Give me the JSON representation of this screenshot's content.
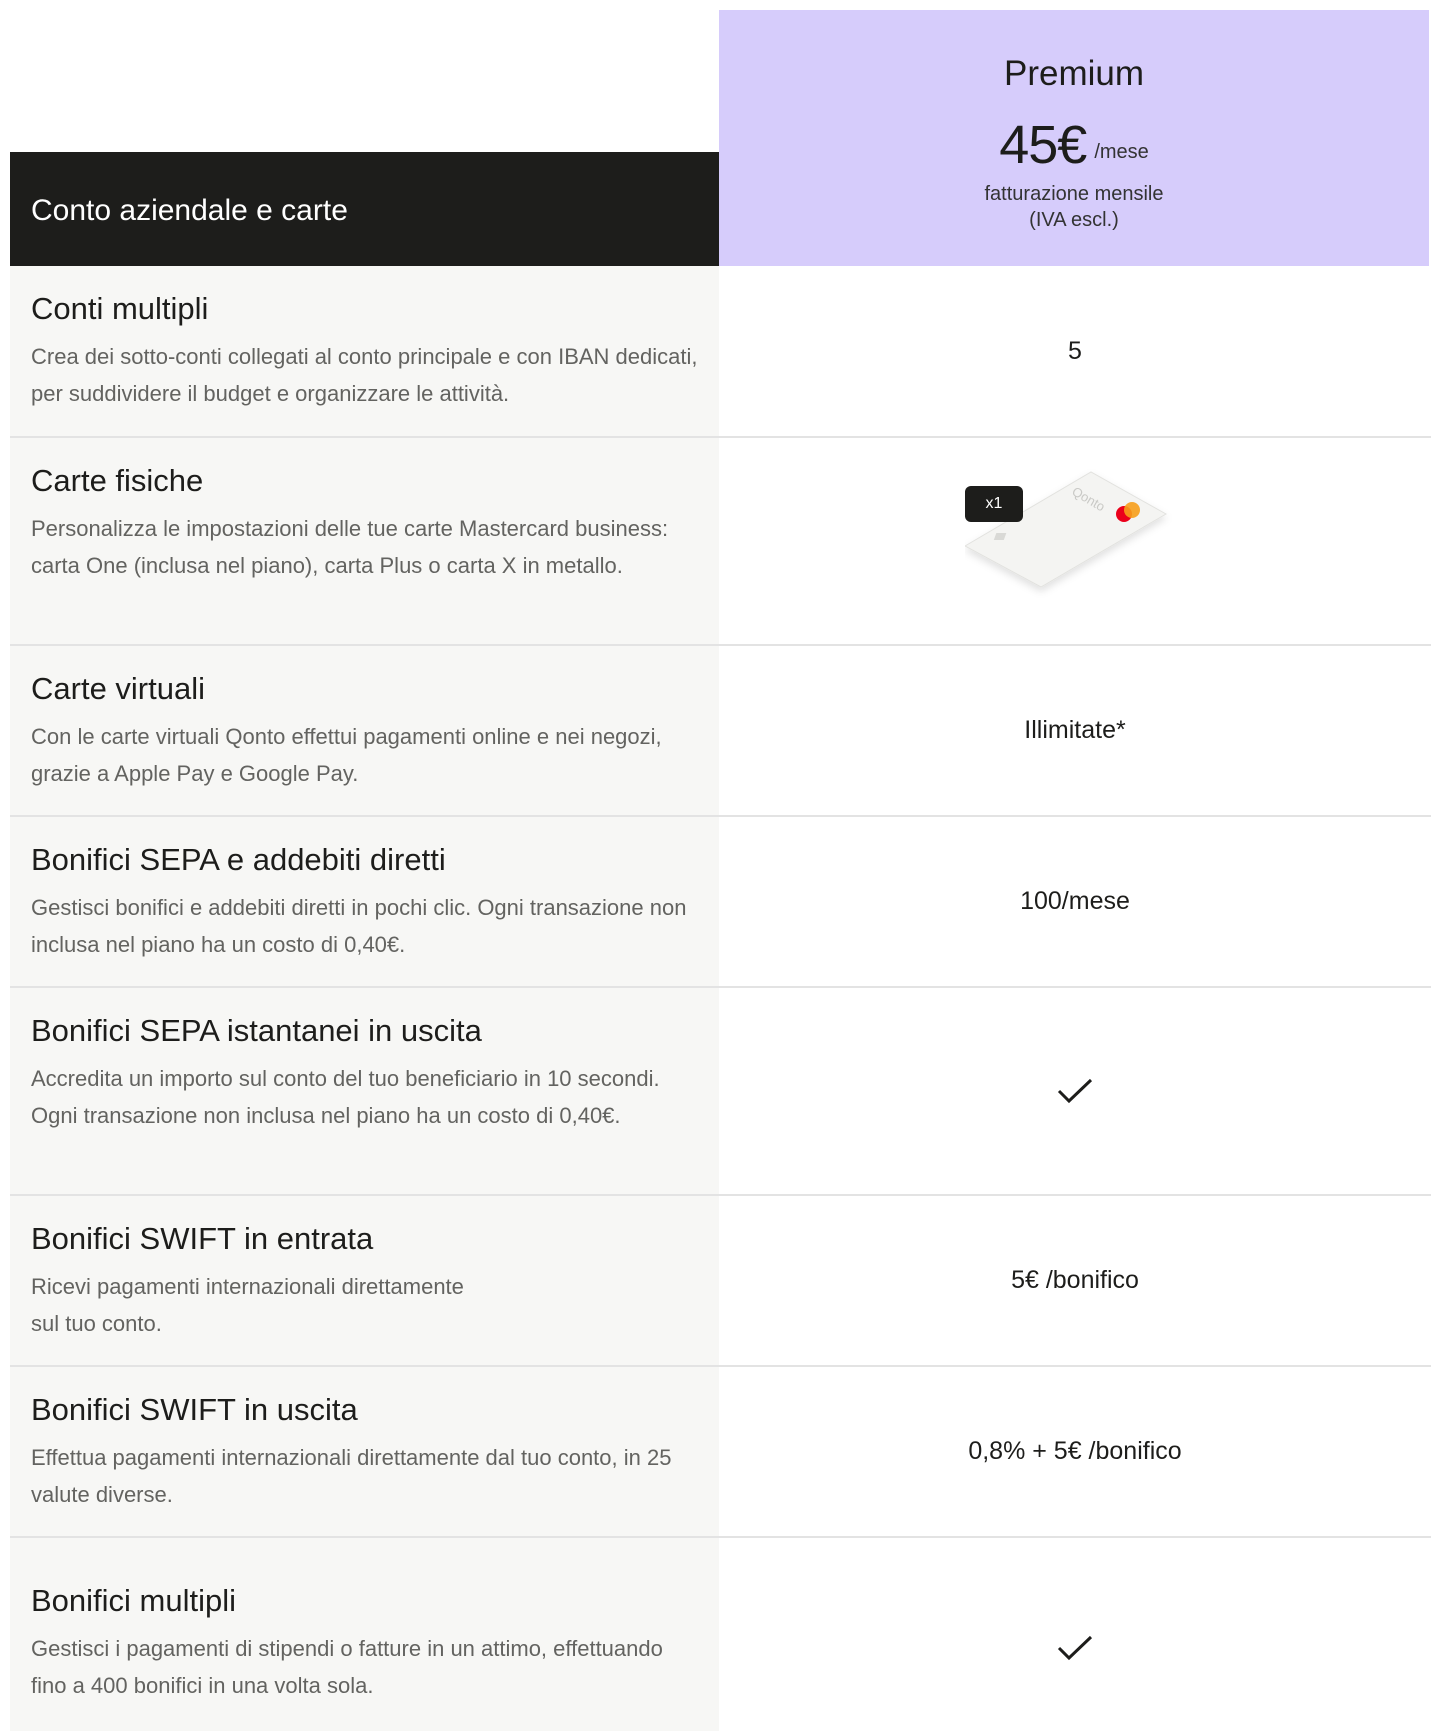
{
  "plan": {
    "name": "Premium",
    "price": "45€",
    "period": "/mese",
    "billing_line1": "fatturazione mensile",
    "billing_line2": "(IVA escl.)"
  },
  "section": {
    "title": "Conto aziendale e carte"
  },
  "rows": [
    {
      "title": "Conti multipli",
      "description": "Crea dei sotto-conti collegati al conto principale e con IBAN dedicati, per suddividere il budget e organizzare le attività.",
      "value": "5"
    },
    {
      "title": "Carte fisiche",
      "description": "Personalizza le impostazioni delle tue carte Mastercard business: carta One (inclusa nel piano), carta Plus o carta X in metallo.",
      "badge": "x1",
      "card_brand": "Qonto",
      "card_icon": "mastercard-card-icon"
    },
    {
      "title": "Carte virtuali",
      "description": "Con le carte virtuali Qonto effettui pagamenti online e nei negozi, grazie a Apple Pay e Google Pay.",
      "value": "Illimitate*"
    },
    {
      "title": "Bonifici SEPA e addebiti diretti",
      "description": "Gestisci bonifici e addebiti diretti in pochi clic. Ogni transazione non inclusa nel piano ha un costo di 0,40€.",
      "value": "100/mese"
    },
    {
      "title": "Bonifici SEPA istantanei in uscita",
      "description": "Accredita un importo sul conto del tuo beneficiario in 10 secondi. Ogni transazione non inclusa nel piano ha un costo di 0,40€.",
      "value_icon": "checkmark-icon"
    },
    {
      "title": "Bonifici SWIFT in entrata",
      "description_line1": "Ricevi pagamenti internazionali direttamente",
      "description_line2": "sul tuo conto.",
      "value": "5€ /bonifico"
    },
    {
      "title": "Bonifici SWIFT in uscita",
      "description": "Effettua pagamenti internazionali direttamente dal tuo conto, in 25 valute diverse.",
      "value": "0,8% + 5€ /bonifico"
    },
    {
      "title": "Bonifici multipli",
      "description": "Gestisci i pagamenti di stipendi o fatture in un attimo, effettuando fino a 400 bonifici in una volta sola.",
      "value_icon": "checkmark-icon"
    }
  ],
  "colors": {
    "plan_bg": "#d6ccfb",
    "header_bg": "#1d1d1b",
    "feature_bg": "#f7f7f5",
    "description_text": "#636360"
  }
}
